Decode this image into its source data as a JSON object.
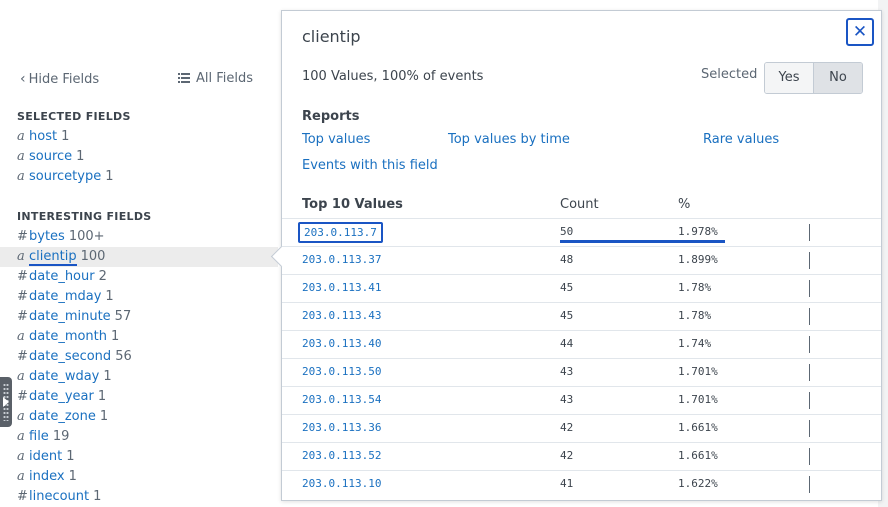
{
  "sidebar": {
    "hide_fields": "Hide Fields",
    "all_fields": "All Fields",
    "selected_title": "SELECTED FIELDS",
    "interesting_title": "INTERESTING FIELDS",
    "selected": [
      {
        "type": "a",
        "name": "host",
        "count": "1"
      },
      {
        "type": "a",
        "name": "source",
        "count": "1"
      },
      {
        "type": "a",
        "name": "sourcetype",
        "count": "1"
      }
    ],
    "interesting": [
      {
        "type": "#",
        "name": "bytes",
        "count": "100+"
      },
      {
        "type": "a",
        "name": "clientip",
        "count": "100"
      },
      {
        "type": "#",
        "name": "date_hour",
        "count": "2"
      },
      {
        "type": "#",
        "name": "date_mday",
        "count": "1"
      },
      {
        "type": "#",
        "name": "date_minute",
        "count": "57"
      },
      {
        "type": "a",
        "name": "date_month",
        "count": "1"
      },
      {
        "type": "#",
        "name": "date_second",
        "count": "56"
      },
      {
        "type": "a",
        "name": "date_wday",
        "count": "1"
      },
      {
        "type": "#",
        "name": "date_year",
        "count": "1"
      },
      {
        "type": "a",
        "name": "date_zone",
        "count": "1"
      },
      {
        "type": "a",
        "name": "file",
        "count": "19"
      },
      {
        "type": "a",
        "name": "ident",
        "count": "1"
      },
      {
        "type": "a",
        "name": "index",
        "count": "1"
      },
      {
        "type": "#",
        "name": "linecount",
        "count": "1"
      }
    ]
  },
  "popover": {
    "title": "clientip",
    "close_glyph": "✕",
    "summary": "100 Values, 100% of events",
    "selected_label": "Selected",
    "yes": "Yes",
    "no": "No",
    "reports_title": "Reports",
    "links": {
      "top_values": "Top values",
      "top_values_by_time": "Top values by time",
      "rare_values": "Rare values",
      "events_with_field": "Events with this field"
    },
    "table": {
      "col_value": "Top 10 Values",
      "col_count": "Count",
      "col_pct": "%",
      "rows": [
        {
          "value": "203.0.113.7",
          "count": "50",
          "pct": "1.978%"
        },
        {
          "value": "203.0.113.37",
          "count": "48",
          "pct": "1.899%"
        },
        {
          "value": "203.0.113.41",
          "count": "45",
          "pct": "1.78%"
        },
        {
          "value": "203.0.113.43",
          "count": "45",
          "pct": "1.78%"
        },
        {
          "value": "203.0.113.40",
          "count": "44",
          "pct": "1.74%"
        },
        {
          "value": "203.0.113.50",
          "count": "43",
          "pct": "1.701%"
        },
        {
          "value": "203.0.113.54",
          "count": "43",
          "pct": "1.701%"
        },
        {
          "value": "203.0.113.36",
          "count": "42",
          "pct": "1.661%"
        },
        {
          "value": "203.0.113.52",
          "count": "42",
          "pct": "1.661%"
        },
        {
          "value": "203.0.113.10",
          "count": "41",
          "pct": "1.622%"
        }
      ]
    }
  },
  "colors": {
    "link": "#1a70c0",
    "focus": "#1a55c4",
    "text": "#3c444d"
  }
}
